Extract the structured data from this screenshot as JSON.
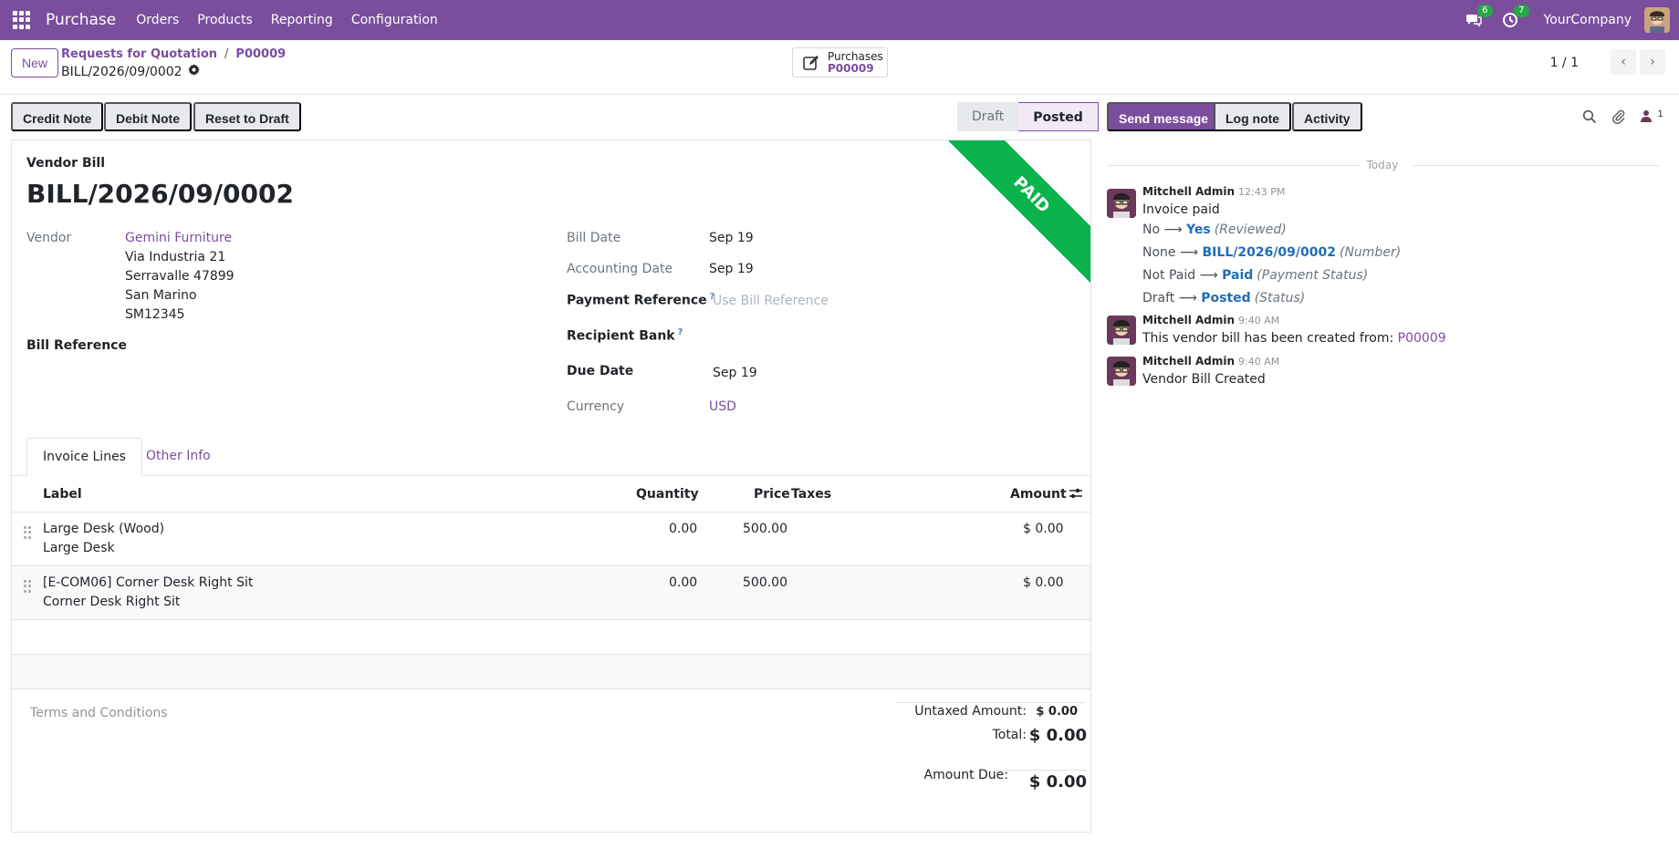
{
  "navbar": {
    "app_name": "Purchase",
    "menu": [
      "Orders",
      "Products",
      "Reporting",
      "Configuration"
    ],
    "messages_count": "6",
    "activities_count": "7",
    "company": "YourCompany"
  },
  "control": {
    "new_label": "New",
    "breadcrumb": [
      "Requests for Quotation",
      "P00009"
    ],
    "record_name": "BILL/2026/09/0002",
    "smart_button": {
      "label": "Purchases",
      "value": "P00009"
    },
    "pager": "1 / 1"
  },
  "actions": {
    "credit_note": "Credit Note",
    "debit_note": "Debit Note",
    "reset": "Reset to Draft"
  },
  "status": {
    "draft": "Draft",
    "posted": "Posted"
  },
  "ribbon": "PAID",
  "form": {
    "doc_type": "Vendor Bill",
    "title": "BILL/2026/09/0002",
    "vendor_label": "Vendor",
    "vendor_name": "Gemini Furniture",
    "vendor_address": [
      "Via Industria 21",
      "Serravalle 47899",
      "San Marino",
      "SM12345"
    ],
    "bill_reference_label": "Bill Reference",
    "bill_date_label": "Bill Date",
    "bill_date": "Sep 19",
    "accounting_date_label": "Accounting Date",
    "accounting_date": "Sep 19",
    "payment_reference_label": "Payment Reference",
    "payment_reference_placeholder": "Use Bill Reference",
    "recipient_bank_label": "Recipient Bank",
    "due_date_label": "Due Date",
    "due_date": "Sep 19",
    "currency_label": "Currency",
    "currency": "USD",
    "help_mark": "?"
  },
  "tabs": [
    "Invoice Lines",
    "Other Info"
  ],
  "table": {
    "headers": {
      "label": "Label",
      "quantity": "Quantity",
      "price": "Price",
      "taxes": "Taxes",
      "amount": "Amount"
    },
    "rows": [
      {
        "label": "Large Desk (Wood)",
        "desc": "Large Desk",
        "quantity": "0.00",
        "price": "500.00",
        "amount": "$ 0.00"
      },
      {
        "label": "[E-COM06] Corner Desk Right Sit",
        "desc": "Corner Desk Right Sit",
        "quantity": "0.00",
        "price": "500.00",
        "amount": "$ 0.00"
      }
    ]
  },
  "totals": {
    "terms": "Terms and Conditions",
    "untaxed_label": "Untaxed Amount:",
    "untaxed": "$ 0.00",
    "total_label": "Total:",
    "total": "$ 0.00",
    "due_label": "Amount Due:",
    "due": "$ 0.00"
  },
  "chatter": {
    "send_message": "Send message",
    "log_note": "Log note",
    "activity": "Activity",
    "followers_count": "1",
    "today": "Today",
    "messages": [
      {
        "author": "Mitchell Admin",
        "time": "12:43 PM",
        "body": "Invoice paid",
        "tracking": [
          {
            "old": "No",
            "new": "Yes",
            "field": "(Reviewed)"
          },
          {
            "old": "None",
            "new": "BILL/2026/09/0002",
            "field": "(Number)"
          },
          {
            "old": "Not Paid",
            "new": "Paid",
            "field": "(Payment Status)"
          },
          {
            "old": "Draft",
            "new": "Posted",
            "field": "(Status)"
          }
        ]
      },
      {
        "author": "Mitchell Admin",
        "time": "9:40 AM",
        "body": "This vendor bill has been created from:",
        "link": "P00009"
      },
      {
        "author": "Mitchell Admin",
        "time": "9:40 AM",
        "body": "Vendor Bill Created"
      }
    ]
  },
  "colors": {
    "brand": "#7b4d9d",
    "paid_ribbon": "#0ab34b",
    "link": "#1f6db3"
  }
}
